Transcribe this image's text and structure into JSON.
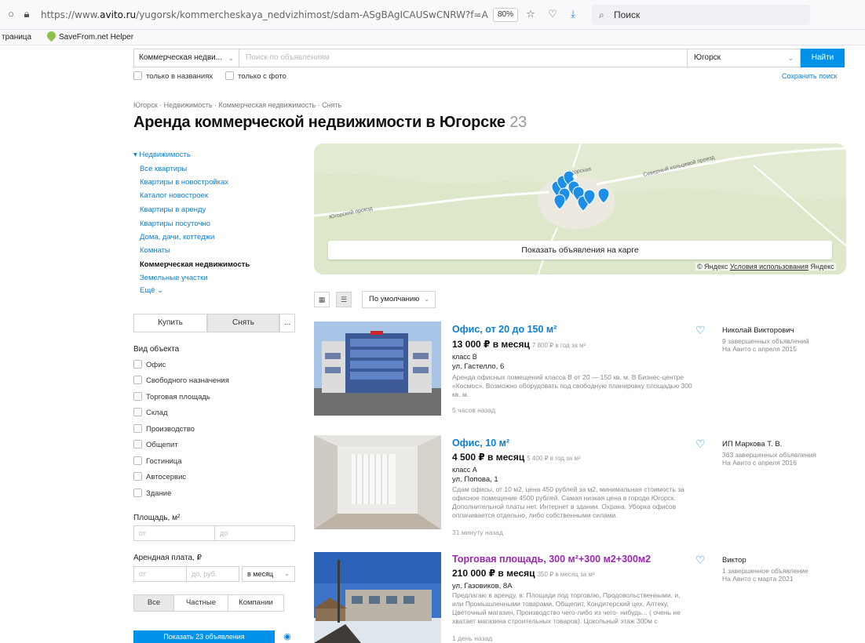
{
  "browser": {
    "url_prefix": "https://www.",
    "url_domain": "avito.ru",
    "url_rest": "/yugorsk/kommercheskaya_nedvizhimost/sdam-ASgBAgICAUSwCNRW?f=ASgBAgIC",
    "zoom": "80%",
    "search_placeholder": "Поиск",
    "bookmark_1": "траница",
    "bookmark_2": "SaveFrom.net Helper"
  },
  "search": {
    "category": "Коммерческая недви...",
    "query_placeholder": "Поиск по объявлениям",
    "city": "Югорск",
    "find_label": "Найти",
    "only_titles": "только в названиях",
    "only_photo": "только с фото",
    "save_search": "Сохранить поиск"
  },
  "breadcrumb": "Югорск · Недвижимость · Коммерческая недвижимость · Снять",
  "page_title": "Аренда коммерческой недвижимости в Югорске",
  "page_count": "23",
  "sidebar": {
    "head": "▾ Недвижимость",
    "items": [
      "Все квартиры",
      "Квартиры в новостройках",
      "Каталог новостроек",
      "Квартиры в аренду",
      "Квартиры посуточно",
      "Дома, дачи, коттеджи",
      "Комнаты",
      "Коммерческая недвижимость",
      "Земельные участки",
      "Ещё ⌄"
    ]
  },
  "deal": {
    "buy": "Купить",
    "rent": "Снять",
    "more": "..."
  },
  "filters": {
    "object_type_label": "Вид объекта",
    "object_types": [
      "Офис",
      "Свободного назначения",
      "Торговая площадь",
      "Склад",
      "Производство",
      "Общепит",
      "Гостиница",
      "Автосервис",
      "Здание"
    ],
    "area_label": "Площадь, м²",
    "area_from": "от",
    "area_to": "до",
    "rent_label": "Арендная плата, ₽",
    "rent_from": "от",
    "rent_to": "до, руб.",
    "rent_period": "в месяц",
    "seller_all": "Все",
    "seller_private": "Частные",
    "seller_company": "Компании",
    "show_button": "Показать 23 объявления"
  },
  "map": {
    "show_on_map": "Показать объявления на карге",
    "attrib_brand": "© Яндекс",
    "attrib_terms": "Условия использования",
    "attrib_logo": "Яндекс",
    "road_label_1": "Северный кольцевой проезд",
    "road_label_2": "Югорский проезд",
    "road_label_3": "Югорская"
  },
  "sort": {
    "label": "По умолчанию"
  },
  "listings": [
    {
      "title": "Офис, от 20 до 150 м²",
      "price": "13 000 ₽ в месяц",
      "per_unit": "7 800 ₽ в год за м²",
      "class": "класс B",
      "address": "ул. Гастелло, 6",
      "description": "Аренда офисных помещений класса В от 20 — 150 кв. м. В Бизнес-центре «Космос». Возможно оборудовать под свободную планировку площадью 300 кв. м.",
      "time": "5 часов назад",
      "seller": "Николай Викторович",
      "seller_ads": "9 завершенных объявлений",
      "seller_since": "На Авито с апреля 2015"
    },
    {
      "title": "Офис, 10 м²",
      "price": "4 500 ₽ в месяц",
      "per_unit": "5 400 ₽ в год за м²",
      "class": "класс А",
      "address": "ул. Попова, 1",
      "description": "Сдам офисы, от 10 м2, цена 450 рублей за м2, минимальная стоимость за офисное помещение 4500 рублей. Самая низкая цена в городе Югорск. Дополнительной платы нет. Интернет в здании. Охрана. Уборка офисов оплачивается отдельно, либо собственными силами.",
      "time": "31 минуту назад",
      "seller": "ИП Маркова Т. В.",
      "seller_ads": "363 завершенных объявления",
      "seller_since": "На Авито с апреля 2016"
    },
    {
      "title": "Торговая площадь, 300 м²+300 м2+300м2",
      "price": "210 000 ₽ в месяц",
      "per_unit": "350 ₽ в месяц за м²",
      "class": "",
      "address": "ул. Газовиков, 8А",
      "description": "Предлагаю в аренду, в: Площади под торговлю, Продовольственными, и, или Промышленными товарами, Общепит, Кондитерский цех, Аптеку, Цветочный магазин, Производство чего-либо из чего- нибудь... ( очень не хватает магазина строительных товаров). Цокольный этаж 300м с",
      "time": "1 день назад",
      "seller": "Виктор",
      "seller_ads": "1 завершенное объявление",
      "seller_since": "На Авито с марта 2021"
    }
  ]
}
